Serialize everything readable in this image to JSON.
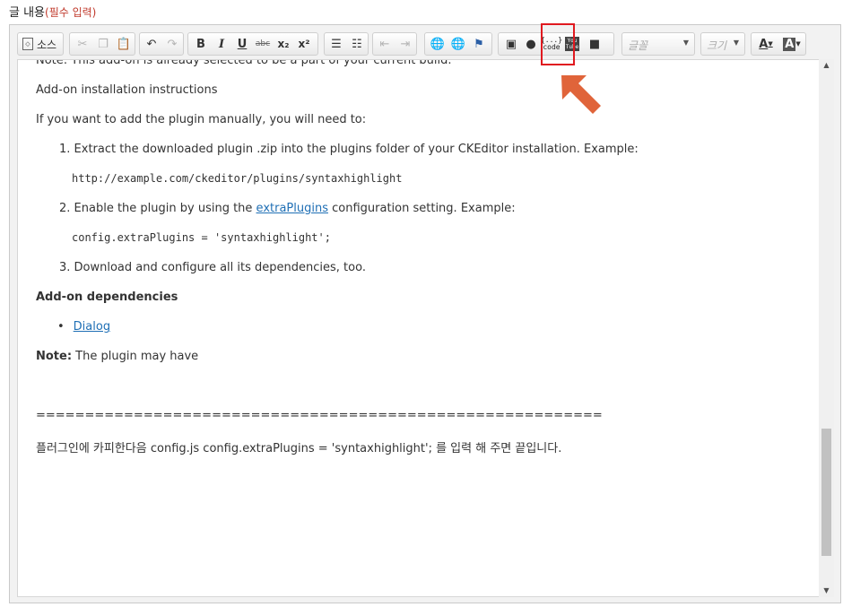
{
  "field": {
    "label": "글 내용",
    "required": "(필수 입력)"
  },
  "toolbar": {
    "source_label": "소스",
    "icons": {
      "cut": "cut-icon",
      "copy": "copy-icon",
      "paste": "paste-icon",
      "undo": "undo-icon",
      "redo": "redo-icon",
      "bold": "B",
      "italic": "I",
      "underline": "U",
      "strike": "abc",
      "subscript": "x₂",
      "superscript": "x²",
      "numbered_list": "numbered-list-icon",
      "bullet_list": "bullet-list-icon",
      "outdent": "outdent-icon",
      "indent": "indent-icon",
      "link": "link-icon",
      "unlink": "unlink-icon",
      "anchor": "anchor-icon",
      "image": "image-icon",
      "map": "map-pin-icon",
      "code": "code-snippet-icon",
      "youtube": "youtube-icon",
      "video": "video-icon",
      "text_color": "A",
      "bg_color": "A"
    },
    "code_label": "{...}\ncode",
    "youtube_label": "You\nTube",
    "font_placeholder": "글꼴",
    "size_placeholder": "크기"
  },
  "content": {
    "note_top": "Note: This add-on is already selected to be a part of your current build.",
    "install_heading": "Add-on installation instructions",
    "intro": "If you want to add the plugin manually, you will need to:",
    "step1": "1. Extract the downloaded plugin .zip into the plugins folder of your CKEditor installation. Example:",
    "step1_code": "http://example.com/ckeditor/plugins/syntaxhighlight",
    "step2_pre": "2. Enable the plugin by using the ",
    "step2_link": "extraPlugins",
    "step2_post": " configuration setting. Example:",
    "step2_code": "config.extraPlugins = 'syntaxhighlight';",
    "step3": "3. Download and configure all its dependencies, too.",
    "deps_heading": "Add-on dependencies",
    "dep1": "Dialog",
    "note_label": "Note:",
    "note_text": " The plugin may have",
    "separator": "==========================================================",
    "korean_line": "플러그인에 카피한다음 config.js  config.extraPlugins = 'syntaxhighlight'; 를 입력 해 주면 끝입니다."
  },
  "colors": {
    "highlight": "#e0191f",
    "arrow": "#e0643a",
    "link": "#1f6fb5"
  }
}
